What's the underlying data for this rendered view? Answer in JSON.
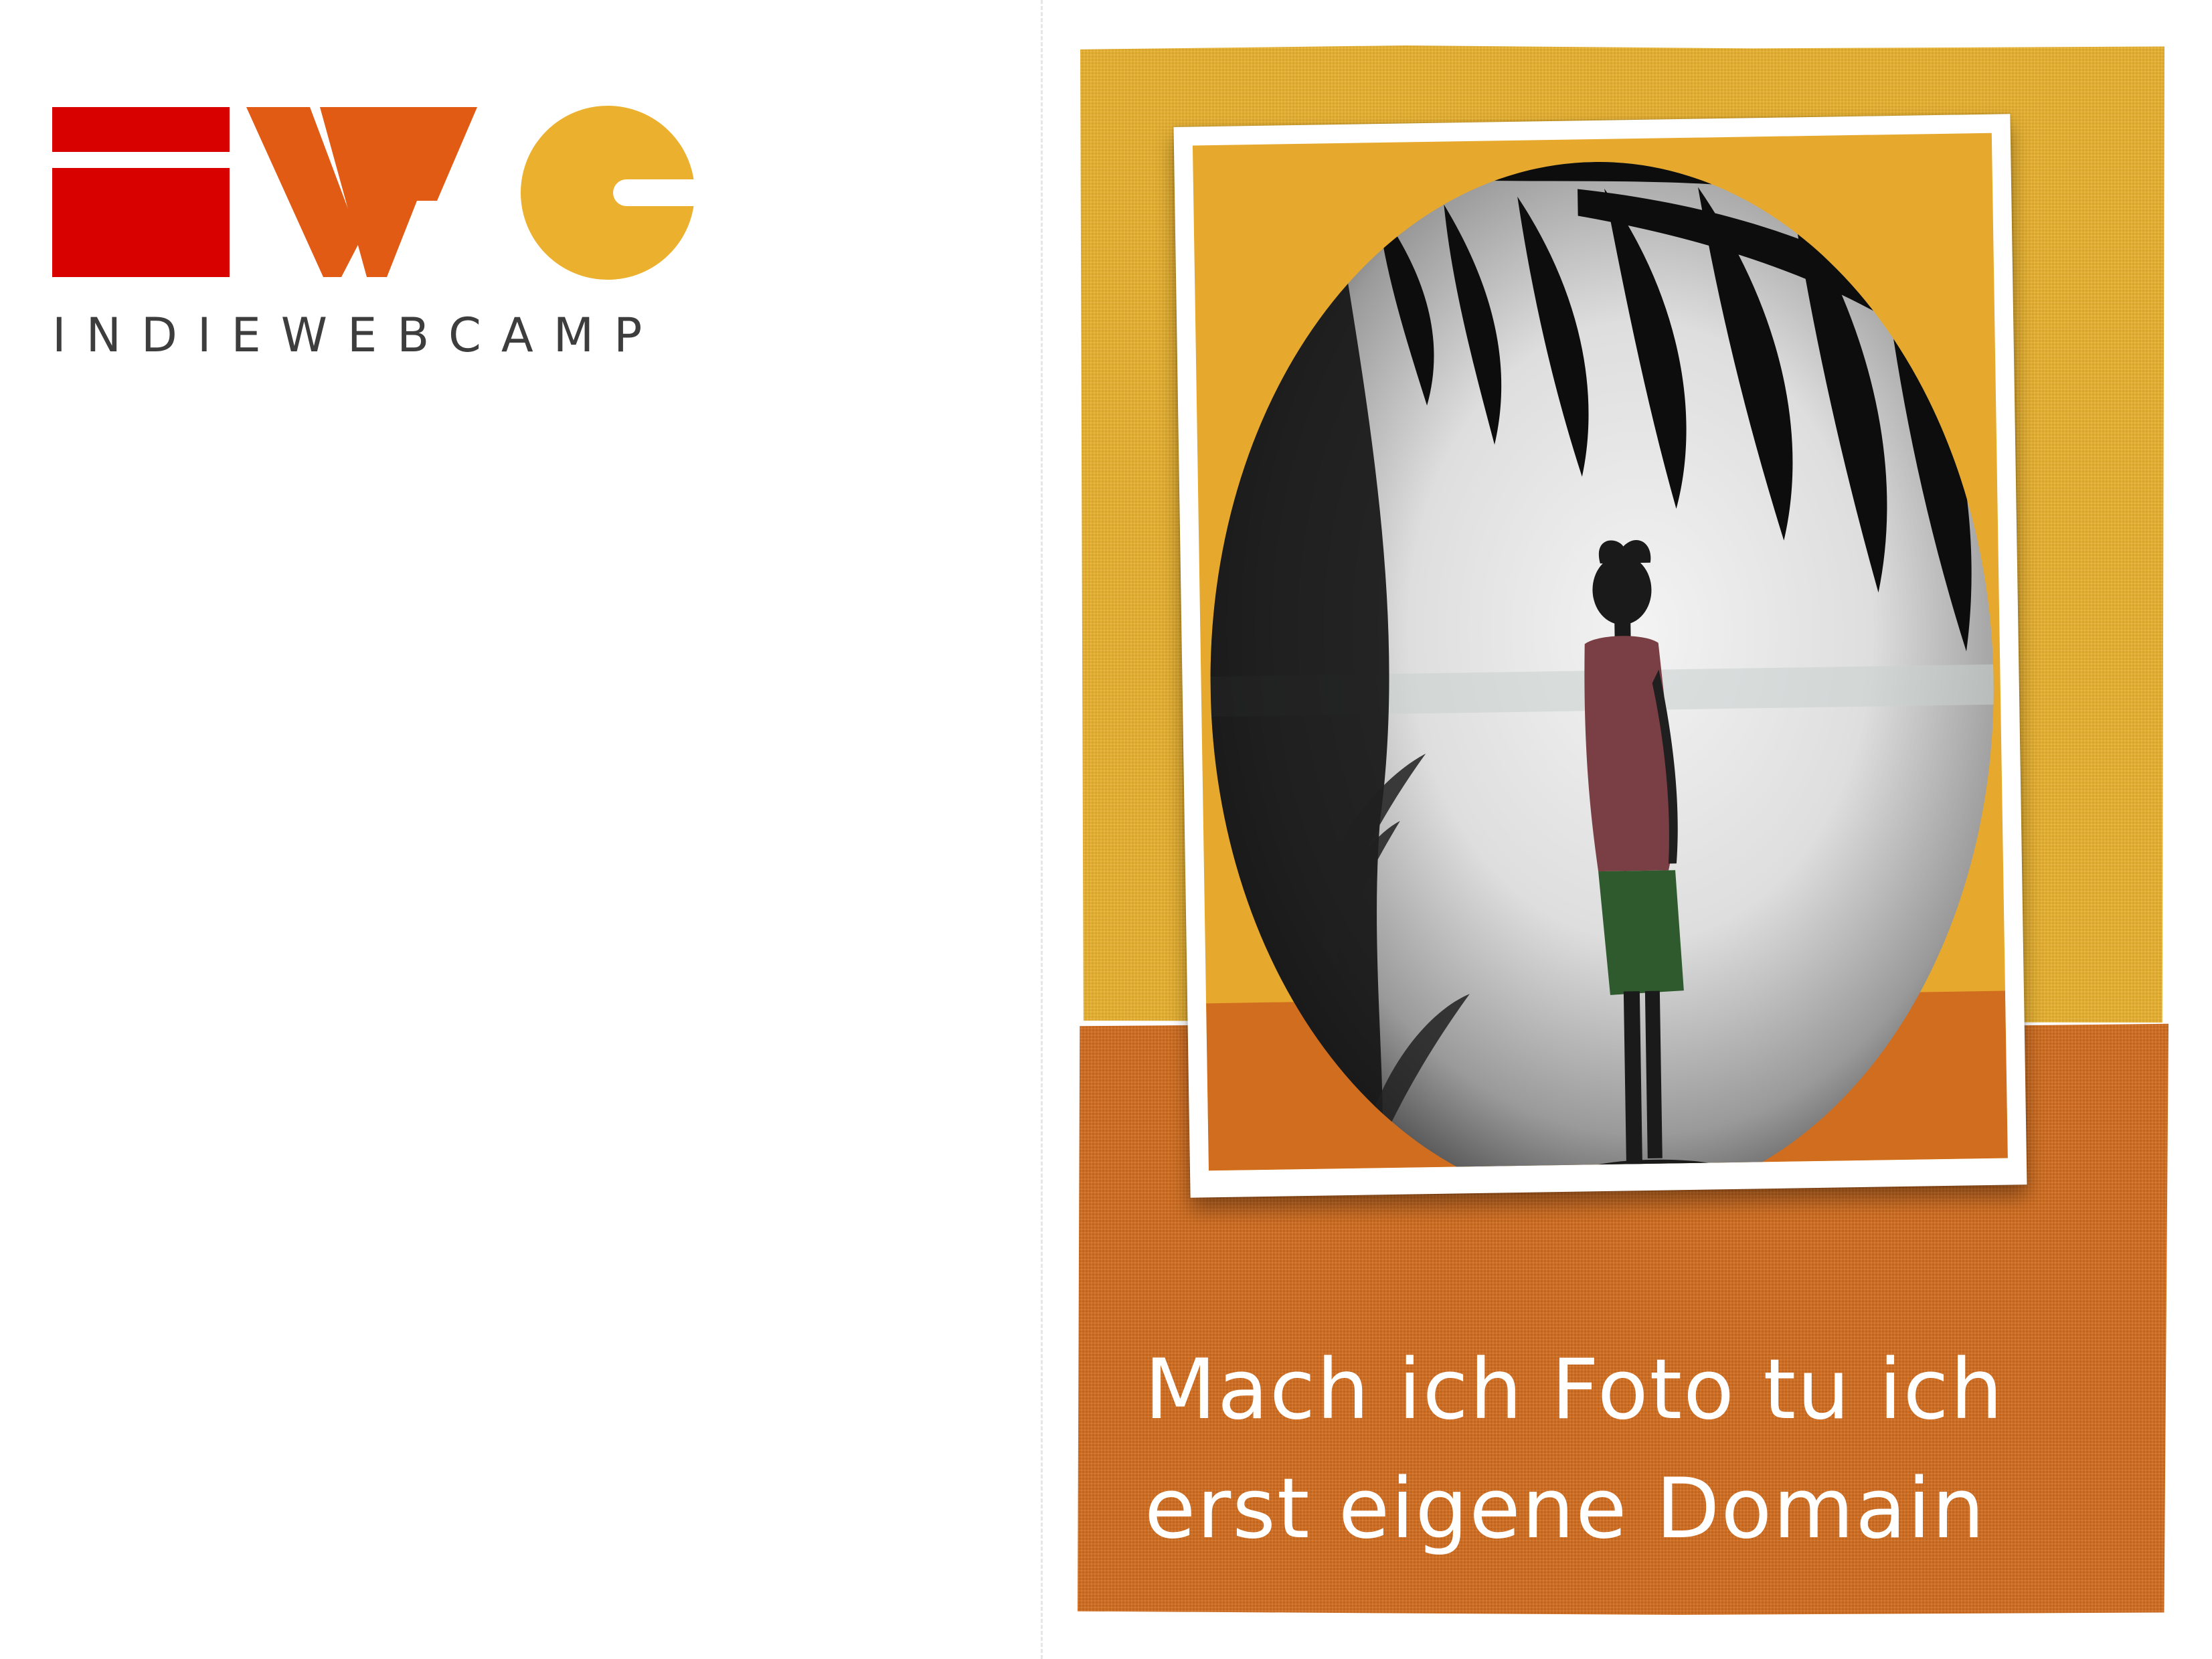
{
  "logo": {
    "wordmark": "INDIEWEBCAMP",
    "colors": {
      "red": "#d90000",
      "orange": "#e25b14",
      "yellow": "#ebb02d",
      "text": "#3d3d3d"
    }
  },
  "card": {
    "colors": {
      "top_band": "#e7b02e",
      "bottom_band": "#d16d1f",
      "frame": "#ffffff"
    },
    "photo": {
      "subject_icon": "silhouette-icon"
    },
    "caption": {
      "line1": "Mach ich Foto tu ich",
      "line2": "erst eigene Domain"
    }
  }
}
